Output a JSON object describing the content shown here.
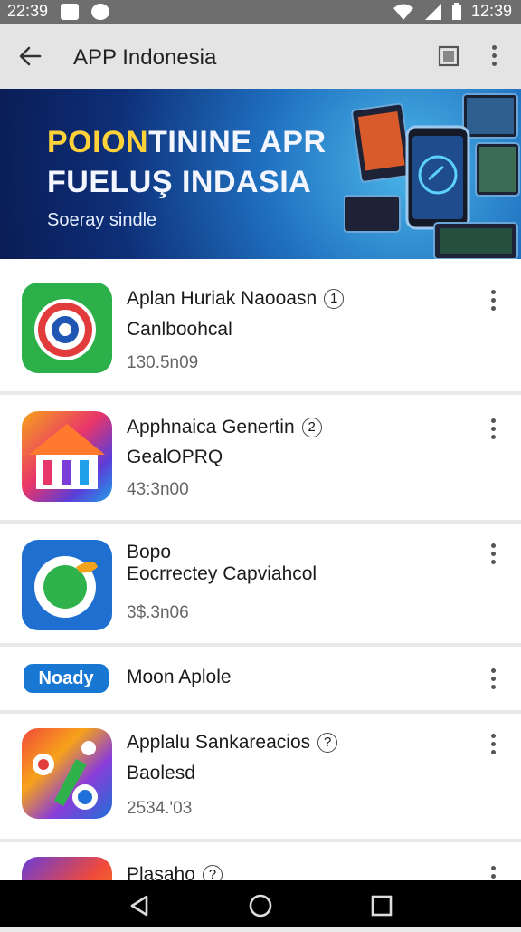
{
  "status_bar": {
    "time": "22:39",
    "clock_right": "12:39"
  },
  "app_bar": {
    "title": "APP Indonesia",
    "back_icon": "arrow-left-icon",
    "action_icon": "square-icon",
    "overflow_icon": "more-vert-icon"
  },
  "banner": {
    "line1_highlight": "POION",
    "line1_rest": "TININE APR",
    "line2": "FUELUŞ INDASIA",
    "subtitle": "Soeray sindle"
  },
  "apps": [
    {
      "name": "Aplan Huriak Naooasn",
      "badge": "1",
      "subtitle": "Canlboohcal",
      "count": "130.5n09",
      "icon": "target-icon"
    },
    {
      "name": "Apphnaica Genertin",
      "badge": "2",
      "subtitle": "GealOPRQ",
      "count": "43:3n00",
      "icon": "house-icon"
    },
    {
      "name": "Bopo",
      "badge": "",
      "subtitle": "Eocrrectey Capviahcol",
      "count": "3$.3n06",
      "icon": "gear-leaf-icon"
    },
    {
      "name": "Moon Aplole",
      "badge": "",
      "subtitle": "",
      "count": "",
      "pill": "Noady",
      "icon": ""
    },
    {
      "name": "Applalu Sankareacios",
      "badge": "?",
      "subtitle": "Baolesd",
      "count": "2534.'03",
      "icon": "colorful-app-icon"
    },
    {
      "name": "Plasaho",
      "badge": "?",
      "subtitle": "",
      "count": "",
      "icon": "colorful-app-icon"
    }
  ],
  "colors": {
    "accent": "#1977d4",
    "banner_yellow": "#ffd23a"
  }
}
